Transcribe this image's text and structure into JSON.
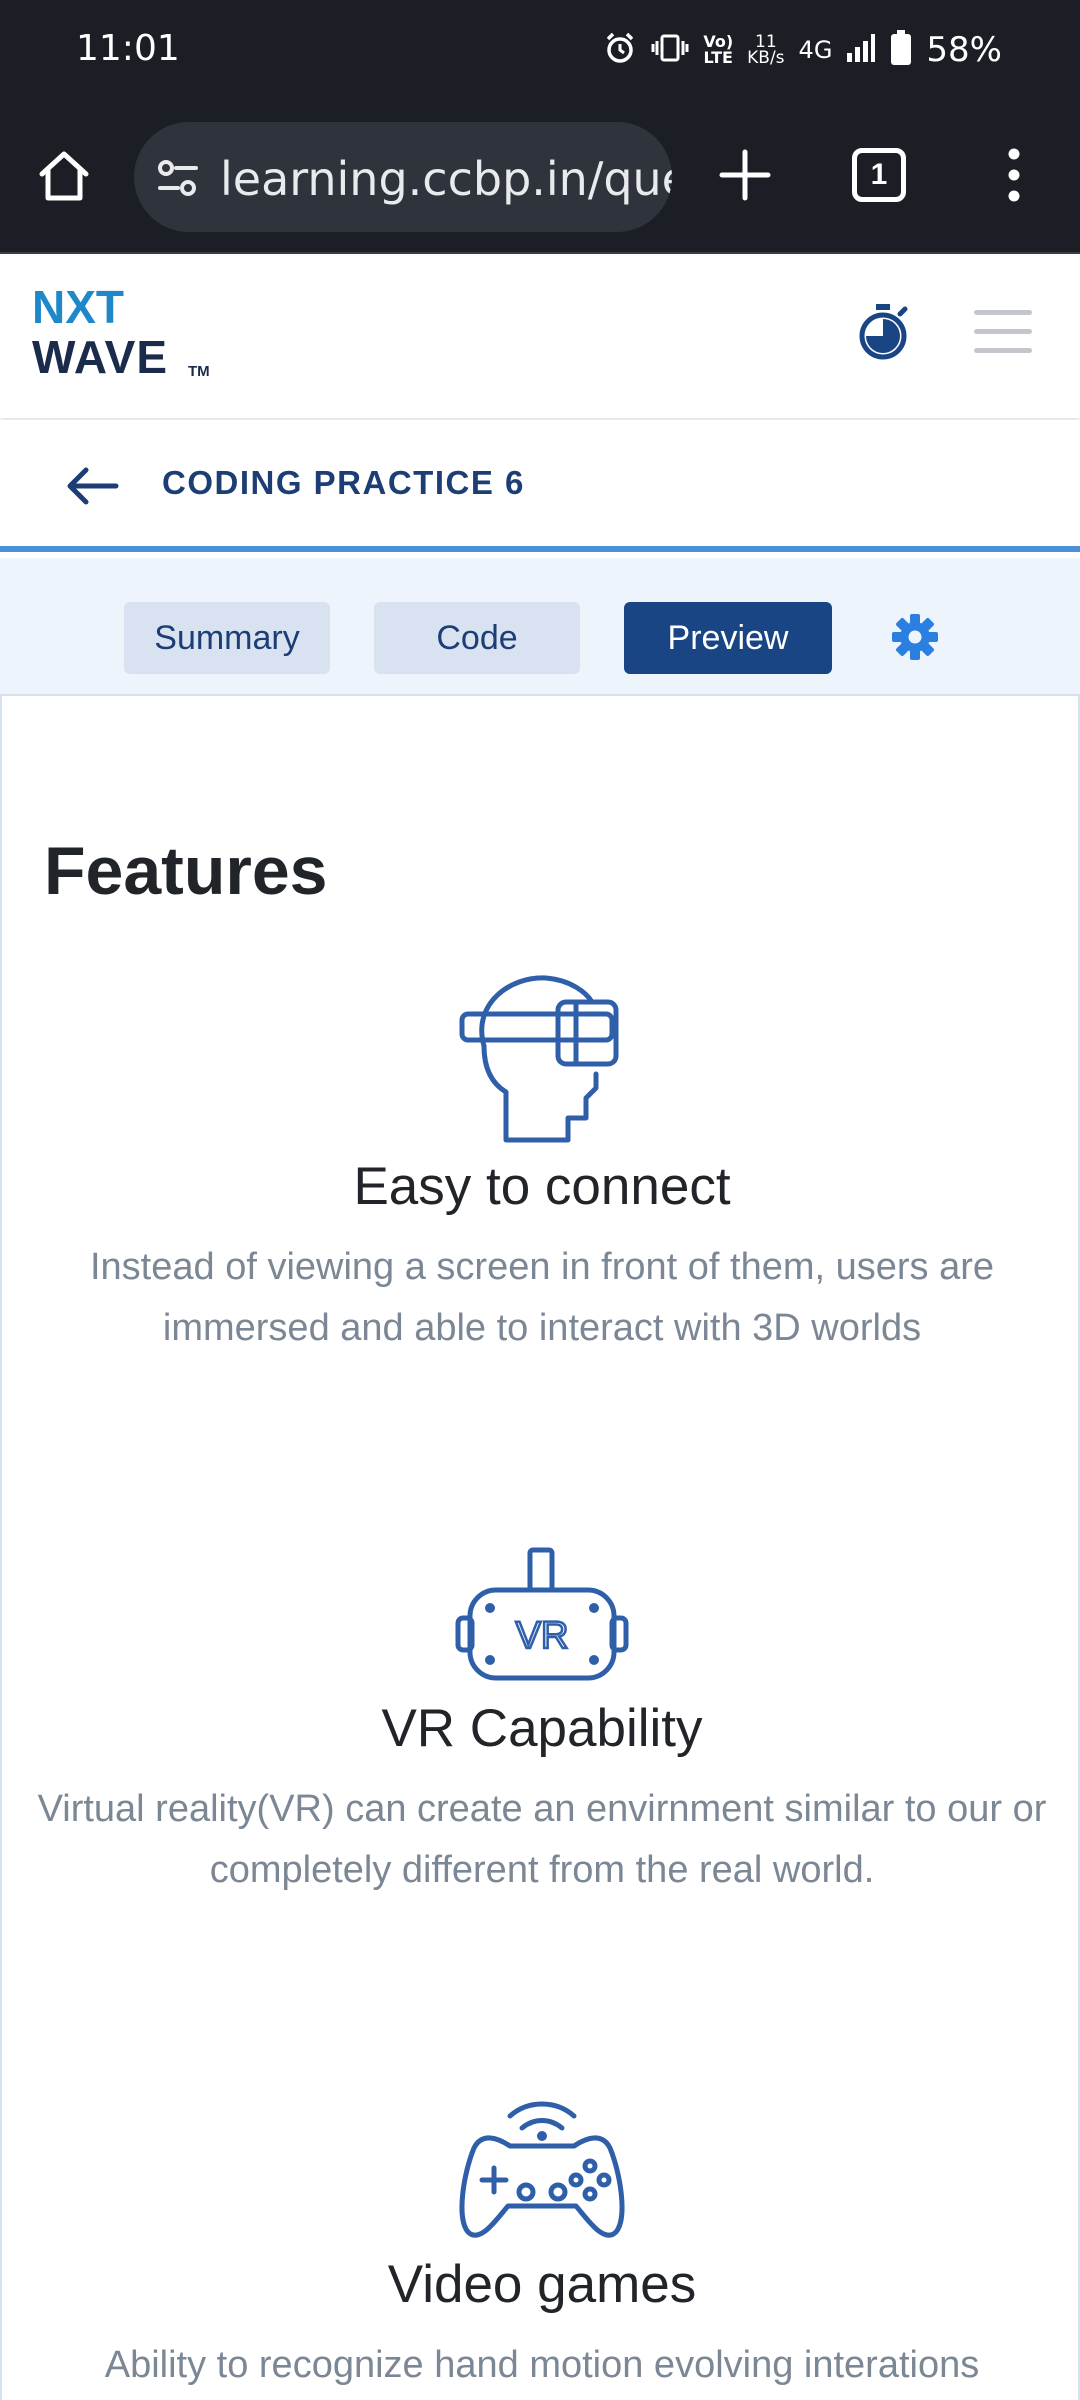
{
  "status_bar": {
    "time": "11:01",
    "volte_top": "Vo)",
    "volte_bottom": "LTE",
    "speed_value": "11",
    "speed_unit": "KB/s",
    "network": "4G",
    "battery": "58%"
  },
  "browser": {
    "url": "learning.ccbp.in/que",
    "tab_count": "1"
  },
  "header": {
    "logo_top": "NXT",
    "logo_bottom": "WAVE",
    "logo_tm": "TM"
  },
  "breadcrumb": {
    "title": "CODING PRACTICE 6"
  },
  "tabs": [
    {
      "label": "Summary",
      "active": false
    },
    {
      "label": "Code",
      "active": false
    },
    {
      "label": "Preview",
      "active": true
    }
  ],
  "preview": {
    "heading": "Features",
    "features": [
      {
        "icon": "vr-headset-head-icon",
        "title": "Easy to connect",
        "description": "Instead of viewing a screen in front of them, users are immersed and able to interact with 3D worlds"
      },
      {
        "icon": "vr-goggles-icon",
        "icon_text": "VR",
        "title": "VR Capability",
        "description": "Virtual reality(VR) can create an envirnment similar to our or completely different from the real world."
      },
      {
        "icon": "gamepad-icon",
        "title": "Video games",
        "description": "Ability to recognize hand motion evolving interations"
      }
    ]
  },
  "colors": {
    "brand_dark_blue": "#1a4585",
    "accent_blue": "#4a90d9",
    "icon_blue": "#2f5fa8",
    "gear_blue": "#2b7fe0"
  }
}
